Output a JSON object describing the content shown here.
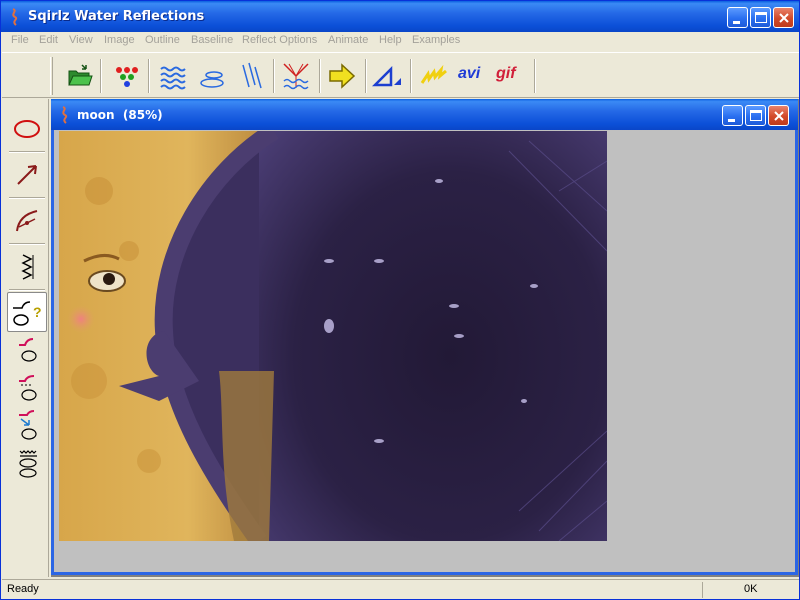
{
  "window": {
    "title": "Sqirlz Water Reflections"
  },
  "menu": [
    "File",
    "Edit",
    "View",
    "Image",
    "Outline",
    "Baseline",
    "Reflect Options",
    "Animate",
    "Help",
    "Examples"
  ],
  "toolbar": {
    "buttons": [
      {
        "icon": "open-folder-icon"
      },
      {
        "icon": "color-dots-icon"
      },
      {
        "icon": "waves-icon"
      },
      {
        "icon": "ripples-icon"
      },
      {
        "icon": "rain-icon"
      },
      {
        "icon": "fountain-icon"
      },
      {
        "icon": "arrow-right-icon"
      },
      {
        "icon": "triangle-icon"
      },
      {
        "icon": "lightning-icon"
      }
    ],
    "avi_label": "avi",
    "gif_label": "gif"
  },
  "tools": [
    {
      "icon": "ellipse-icon"
    },
    {
      "icon": "arrow-icon"
    },
    {
      "icon": "arc-icon"
    },
    {
      "icon": "zigzag-icon"
    },
    {
      "icon": "outline-help-icon",
      "active": true
    },
    {
      "icon": "outline-tool-1-icon"
    },
    {
      "icon": "outline-tool-2-icon"
    },
    {
      "icon": "outline-tool-3-icon"
    },
    {
      "icon": "outline-tool-4-icon"
    }
  ],
  "document": {
    "title": "moon  (85%)"
  },
  "status": {
    "text": "Ready",
    "value": "0K"
  },
  "colors": {
    "titlebar": "#0b50d8",
    "menu_disabled": "#a3a19a",
    "avi": "#1f3bd6",
    "gif": "#d1203a"
  }
}
